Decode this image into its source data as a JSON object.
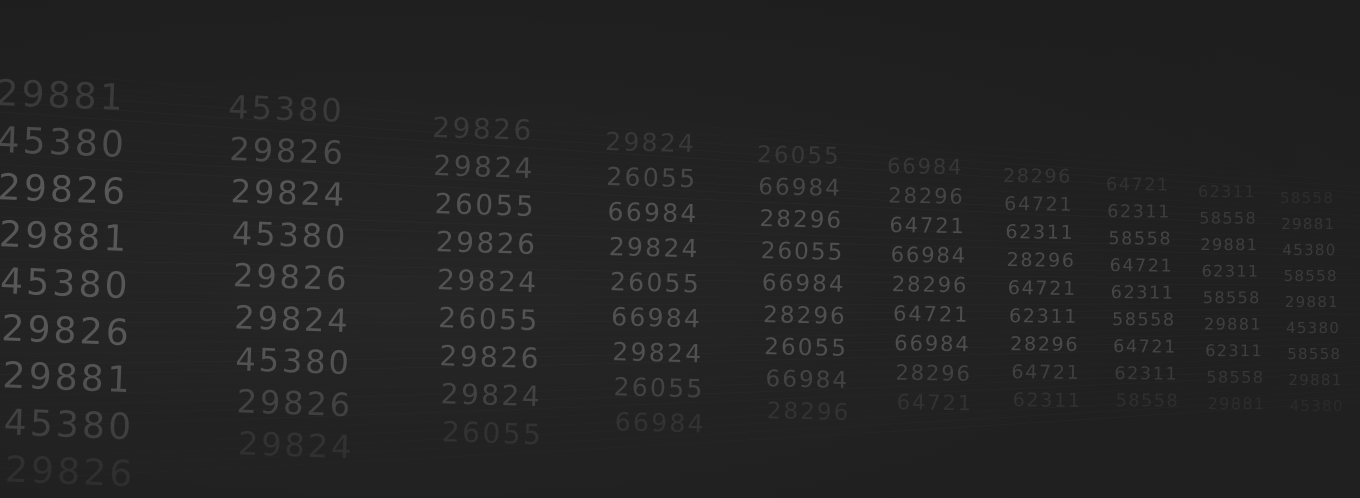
{
  "scene": {
    "background_color": "#212121",
    "text_color": "#5a5a5a",
    "rows": [
      [
        "29881",
        "45380",
        "29826",
        "29824",
        "26055",
        "66984",
        "28296",
        "64721",
        "62311",
        "58558"
      ],
      [
        "45380",
        "29826",
        "29824",
        "26055",
        "66984",
        "28296",
        "64721",
        "62311",
        "58558",
        "29881"
      ],
      [
        "29826",
        "29824",
        "26055",
        "66984",
        "28296",
        "64721",
        "62311",
        "58558",
        "29881",
        "45380"
      ],
      [
        "29881",
        "45380",
        "29826",
        "29824",
        "26055",
        "66984",
        "28296",
        "64721",
        "62311",
        "58558"
      ],
      [
        "45380",
        "29826",
        "29824",
        "26055",
        "66984",
        "28296",
        "64721",
        "62311",
        "58558",
        "29881"
      ],
      [
        "29826",
        "29824",
        "26055",
        "66984",
        "28296",
        "64721",
        "62311",
        "58558",
        "29881",
        "45380"
      ],
      [
        "29881",
        "45380",
        "29826",
        "29824",
        "26055",
        "66984",
        "28296",
        "64721",
        "62311",
        "58558"
      ],
      [
        "45380",
        "29826",
        "29824",
        "26055",
        "66984",
        "28296",
        "64721",
        "62311",
        "58558",
        "29881"
      ],
      [
        "29826",
        "29824",
        "26055",
        "66984",
        "28296",
        "64721",
        "62311",
        "58558",
        "29881",
        "45380"
      ]
    ]
  }
}
